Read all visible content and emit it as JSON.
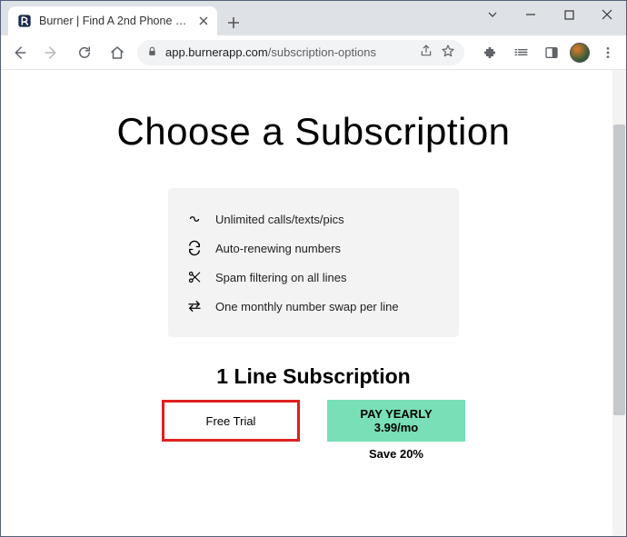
{
  "window": {
    "tab_title": "Burner | Find A 2nd Phone Numb"
  },
  "toolbar": {
    "url_domain": "app.burnerapp.com",
    "url_path": "/subscription-options"
  },
  "page": {
    "heading": "Choose a Subscription",
    "features": [
      "Unlimited calls/texts/pics",
      "Auto-renewing numbers",
      "Spam filtering on all lines",
      "One monthly number swap per line"
    ],
    "sub_heading": "1 Line Subscription",
    "trial_label": "Free Trial",
    "yearly_label": "PAY YEARLY",
    "yearly_price": "3.99/mo",
    "yearly_save": "Save 20%"
  }
}
